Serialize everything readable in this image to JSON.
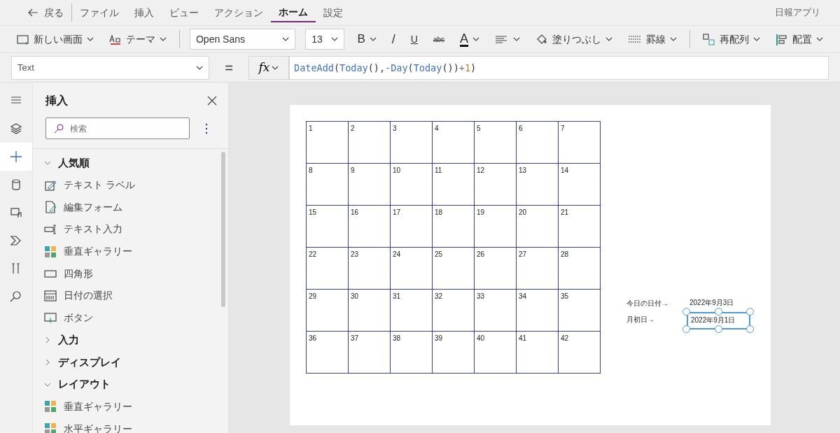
{
  "back": {
    "label": "戻る"
  },
  "menu": [
    {
      "label": "ファイル",
      "selected": false
    },
    {
      "label": "挿入",
      "selected": false
    },
    {
      "label": "ビュー",
      "selected": false
    },
    {
      "label": "アクション",
      "selected": false
    },
    {
      "label": "ホーム",
      "selected": true
    },
    {
      "label": "設定",
      "selected": false
    }
  ],
  "app_name": "日報アプリ",
  "toolbar": [
    {
      "kind": "dropdown",
      "label": "新しい画面"
    },
    {
      "kind": "dropdown",
      "label": "テーマ"
    },
    {
      "kind": "select",
      "label": "Open Sans"
    },
    {
      "kind": "select",
      "label": "13"
    },
    {
      "kind": "char",
      "label": "B"
    },
    {
      "kind": "char",
      "label": "/"
    },
    {
      "kind": "char",
      "label": "U"
    },
    {
      "kind": "char",
      "label": "abc"
    },
    {
      "kind": "char",
      "label": "A"
    },
    {
      "kind": "icon"
    },
    {
      "kind": "dropdown",
      "label": "塗りつぶし"
    },
    {
      "kind": "dropdown",
      "label": "罫線"
    },
    {
      "kind": "dropdown",
      "label": "再配列"
    },
    {
      "kind": "dropdown",
      "label": "配置"
    }
  ],
  "formula_bar": {
    "property": "Text",
    "equals": "=",
    "fx": "fx",
    "tokens": [
      {
        "text": "DateAdd",
        "kind": "function"
      },
      {
        "text": "(",
        "kind": "punct"
      },
      {
        "text": "Today",
        "kind": "function"
      },
      {
        "text": "(),",
        "kind": "punct"
      },
      {
        "text": "-Day",
        "kind": "function"
      },
      {
        "text": "(",
        "kind": "punct"
      },
      {
        "text": "Today",
        "kind": "function"
      },
      {
        "text": "())",
        "kind": "punct"
      },
      {
        "text": "+",
        "kind": "operator"
      },
      {
        "text": "1",
        "kind": "number"
      },
      {
        "text": ")",
        "kind": "punct"
      }
    ]
  },
  "rail": [
    {
      "selected": false
    },
    {
      "selected": false
    },
    {
      "selected": true
    },
    {
      "selected": false
    },
    {
      "selected": false
    },
    {
      "selected": false
    },
    {
      "selected": false
    },
    {
      "selected": false
    }
  ],
  "insert_panel": {
    "title": "挿入",
    "search": {
      "placeholder": "検索"
    },
    "groups": [
      {
        "label": "人気順",
        "expanded": true,
        "children": [
          {
            "kind": "label",
            "label": "テキスト ラベル"
          },
          {
            "kind": "form",
            "label": "編集フォーム"
          },
          {
            "kind": "input",
            "label": "テキスト入力"
          },
          {
            "kind": "gallery",
            "label": "垂直ギャラリー"
          },
          {
            "kind": "rectangle",
            "label": "四角形"
          },
          {
            "kind": "date",
            "label": "日付の選択"
          },
          {
            "kind": "button",
            "label": "ボタン"
          }
        ]
      },
      {
        "label": "入力",
        "expanded": false
      },
      {
        "label": "ディスプレイ",
        "expanded": false
      },
      {
        "label": "レイアウト",
        "expanded": true,
        "children": [
          {
            "kind": "gallery",
            "label": "垂直ギャラリー"
          },
          {
            "kind": "gallery",
            "label": "水平ギャラリー"
          }
        ]
      }
    ]
  },
  "canvas": {
    "calendar": {
      "cells": [
        "1",
        "2",
        "3",
        "4",
        "5",
        "6",
        "7",
        "8",
        "9",
        "10",
        "11",
        "12",
        "13",
        "14",
        "15",
        "16",
        "17",
        "18",
        "19",
        "20",
        "21",
        "22",
        "23",
        "24",
        "25",
        "26",
        "27",
        "28",
        "29",
        "30",
        "31",
        "32",
        "33",
        "34",
        "35",
        "36",
        "37",
        "38",
        "39",
        "40",
        "41",
        "42"
      ]
    },
    "fields": [
      {
        "caption": "今日の日付→",
        "value": "2022年9月3日",
        "selected": false
      },
      {
        "caption": "月初日→",
        "value": "2022年9月1日",
        "selected": true
      }
    ]
  }
}
